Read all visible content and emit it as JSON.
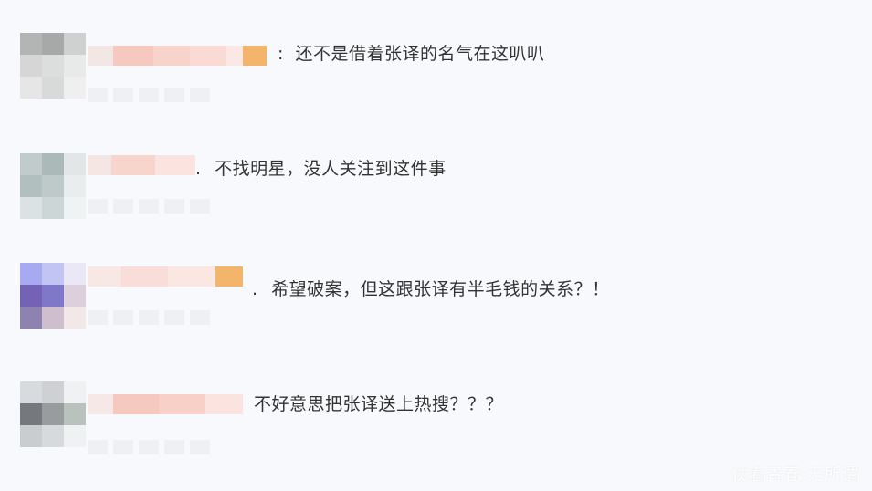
{
  "comments": [
    {
      "separator": ":",
      "text": "还不是借着张译的名气在这叭叭"
    },
    {
      "separator": ".",
      "text": "不找明星，没人关注到这件事"
    },
    {
      "separator": ".",
      "text": "希望破案，但这跟张译有半毛钱的关系？！"
    },
    {
      "separator": "",
      "text": "不好意思把张译送上热搜？？？"
    }
  ],
  "watermark": "仗着青春·无所谓",
  "colors": {
    "background": "#f8f9fc",
    "text": "#333333",
    "name_blur_pink": "#f6c9c0",
    "name_blur_orange": "#f2b56b"
  }
}
